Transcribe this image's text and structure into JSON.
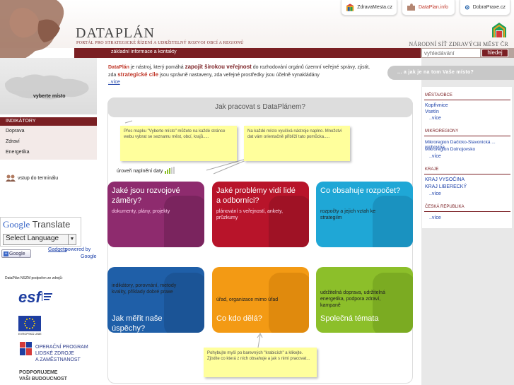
{
  "header": {
    "logo_text": "DATAPLÁN",
    "logo_subtitle": "PORTÁL PRO STRATEGICKÉ ŘÍZENÍ A UDRŽITELNÝ ROZVOJ OBCÍ A REGIONŮ",
    "network_title": "NÁRODNÍ SÍŤ ZDRAVÝCH MĚST ČR",
    "tabs": [
      {
        "label": "ZdravaMesta.cz",
        "icon": "network-icon"
      },
      {
        "label": "DataPlan.info",
        "icon": "puzzle-icon"
      },
      {
        "label": "DobraPraxe.cz",
        "icon": "globe-icon"
      }
    ]
  },
  "menu": {
    "info_label": "základní informace a kontakty",
    "search_placeholder": "vyhledávání",
    "search_button": "hledej"
  },
  "left": {
    "map_label": "vyberte místo",
    "indicators_title": "INDIKÁTORY",
    "indicators": [
      "Doprava",
      "Zdraví",
      "Energetika"
    ],
    "terminal_label": "vstup do terminálu",
    "translate": {
      "title_google": "Google",
      "title_rest": "Translate",
      "select_value": "Select Language",
      "gadget_btn": "Google",
      "gadgets_link": "Gadgets",
      "powered_by": "powered by",
      "powered_google": "Google"
    },
    "support_label": "DataPlán NSZM podpořen ze zdrojů:",
    "eu_label": "EVROPSKÁ UNIE",
    "op_text": [
      "OPERAČNÍ PROGRAM",
      "LIDSKÉ ZDROJE",
      "A ZAMĚSTNANOST"
    ],
    "podporujeme": [
      "PODPORUJEME",
      "VAŠI BUDOUCNOST"
    ]
  },
  "intro": {
    "part1": "DataPlán",
    "part2": " je nástroj, který pomáhá ",
    "part3": "zapojit širokou veřejnost",
    "part4": " do rozhodování orgánů územní veřejné správy, zjistit, zda ",
    "part5": "strategické cíle",
    "part6": " jsou správně nastaveny, zda veřejné prostředky jsou účelně vynakládány",
    "more": "..více"
  },
  "main": {
    "title": "Jak pracovat s DataPlánem?",
    "note_left": "Přes mapku \"Vyberte místo\" můžete na každé stránce webu vybrat se seznamu měst, obcí, krajů.....",
    "note_right": "Na každé místo vyučívá nástroje napl­no. Množství dat vám orientačně přiblíží tato pomůcka.....",
    "note_bottom": "Pohybujte myší po barevných \"krabicích\" a klikejte. Zjistíte co která z nich obsahuje a jak s nimi pracovat...",
    "level_label": "úroveň naplnění daty",
    "cards": [
      {
        "question": "Jaké jsou rozvojové záměry?",
        "sub": "dokumenty, plány, projekty",
        "color": "#8e2b6e"
      },
      {
        "question": "Jaké problémy vidí lidé a odborníci?",
        "sub": "plánování s veřejností, ankety, průzkumy",
        "color": "#b8142a"
      },
      {
        "question": "Co obsahuje rozpočet?",
        "sub": "rozpočty a jejich vztah ke strategiím",
        "color": "#1fa7d6"
      },
      {
        "question": "Jak měřit naše úspěchy?",
        "sub": "indikátory, porovnání, metody kvality, příklady dobré praxe",
        "color": "#1f5fa8"
      },
      {
        "question": "Co kdo dělá?",
        "sub": "úřad, organizace mimo úřad",
        "color": "#f39a14"
      },
      {
        "question": "Společná témata",
        "sub": "udržitelná doprava, udržitelná energetika, podpora zdraví, kampaně",
        "color": "#8cbf2a"
      }
    ]
  },
  "right": {
    "hint": "... a jak je na tom Vaše místo?",
    "sections": [
      {
        "title": "MĚSTA/OBCE",
        "links": [
          "Kopřivnice",
          "Vsetín"
        ],
        "more": "..více"
      },
      {
        "title": "MIKROREGIONY",
        "links": [
          "Mikroregion Dačicko-Slavonická ... vrchovina",
          "Mikroregion Dolnojovsko"
        ],
        "more": "..více"
      },
      {
        "title": "KRAJE",
        "links": [
          "KRAJ VYSOČINA",
          "KRAJ LIBERECKÝ"
        ],
        "more": "..více"
      },
      {
        "title": "ČESKÁ REPUBLIKA",
        "links": [],
        "more": "..více"
      }
    ]
  },
  "colors": {
    "brand": "#7a1f23",
    "link": "#1a3fa8",
    "note": "#ffff9c"
  }
}
